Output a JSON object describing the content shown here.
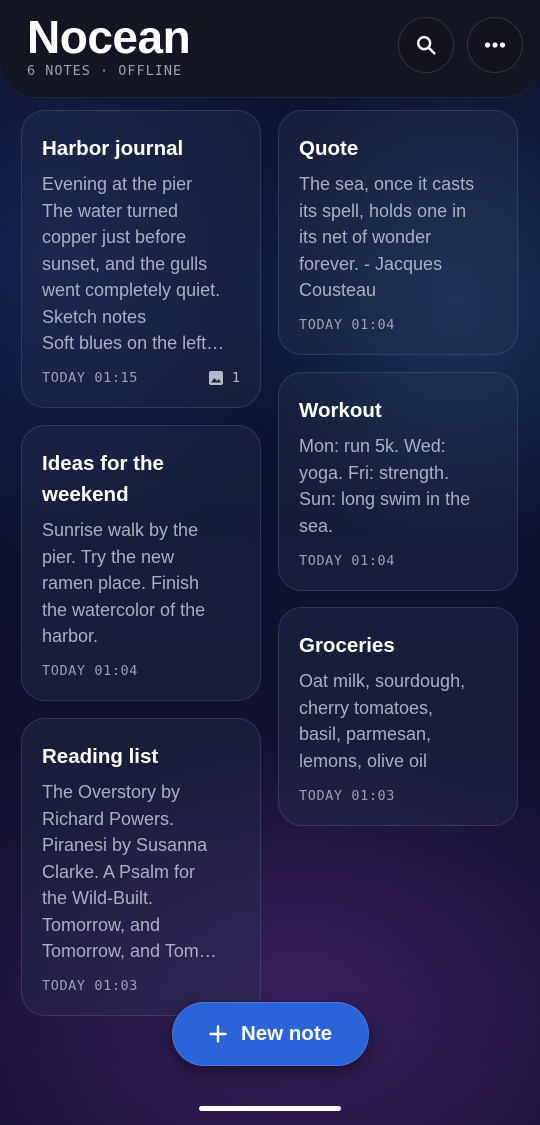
{
  "header": {
    "title": "Nocean",
    "status": "6 NOTES · OFFLINE",
    "search_icon": "search-icon",
    "more_icon": "more-horizontal-icon"
  },
  "notes": [
    {
      "title": "Harbor journal",
      "lines": [
        "Evening at the pier",
        "The water turned",
        "copper just before",
        "sunset, and the gulls",
        "went completely quiet.",
        "Sketch notes",
        "Soft blues on the left…"
      ],
      "timestamp": "TODAY 01:15",
      "attachments": "1",
      "attachment_icon": "image-icon"
    },
    {
      "title": "Quote",
      "lines": [
        "The sea, once it casts",
        "its spell, holds one in",
        "its net of wonder",
        "forever. - Jacques",
        "Cousteau"
      ],
      "timestamp": "TODAY 01:04"
    },
    {
      "title_lines": [
        "Ideas for the",
        "weekend"
      ],
      "lines": [
        "Sunrise walk by the",
        "pier. Try the new",
        "ramen place. Finish",
        "the watercolor of the",
        "harbor."
      ],
      "timestamp": "TODAY 01:04"
    },
    {
      "title": "Workout",
      "lines": [
        "Mon: run 5k. Wed:",
        "yoga. Fri: strength.",
        "Sun: long swim in the",
        "sea."
      ],
      "timestamp": "TODAY 01:04"
    },
    {
      "title": "Groceries",
      "lines": [
        "Oat milk, sourdough,",
        "cherry tomatoes,",
        "basil, parmesan,",
        "lemons, olive oil"
      ],
      "timestamp": "TODAY 01:03"
    },
    {
      "title": "Reading list",
      "lines": [
        "The Overstory by",
        "Richard Powers.",
        "Piranesi by Susanna",
        "Clarke. A Psalm for",
        "the Wild-Built.",
        "Tomorrow, and",
        "Tomorrow, and Tom…"
      ],
      "timestamp": "TODAY 01:03"
    }
  ],
  "fab": {
    "label": "New note",
    "icon": "plus-icon"
  },
  "colors": {
    "accent": "#2b63d9",
    "text_secondary": "#a9afc0"
  }
}
